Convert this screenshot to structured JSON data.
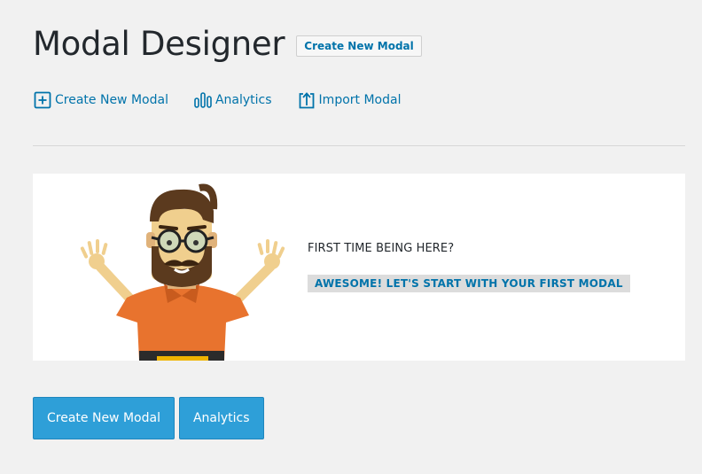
{
  "header": {
    "title": "Modal Designer",
    "create_button_label": "Create New Modal"
  },
  "quick_links": [
    {
      "label": "Create New Modal",
      "icon": "plus-square-icon"
    },
    {
      "label": "Analytics",
      "icon": "bar-chart-icon"
    },
    {
      "label": "Import Modal",
      "icon": "upload-icon"
    }
  ],
  "welcome_panel": {
    "question": "FIRST TIME BEING HERE?",
    "cta_label": "AWESOME! LET'S START WITH YOUR FIRST MODAL",
    "illustration": "hipster-mascot-waving"
  },
  "actions": {
    "create_label": "Create New Modal",
    "analytics_label": "Analytics"
  },
  "colors": {
    "link": "#0073aa",
    "primary_button": "#2e9fd8",
    "background": "#f1f1f1",
    "panel": "#ffffff"
  }
}
